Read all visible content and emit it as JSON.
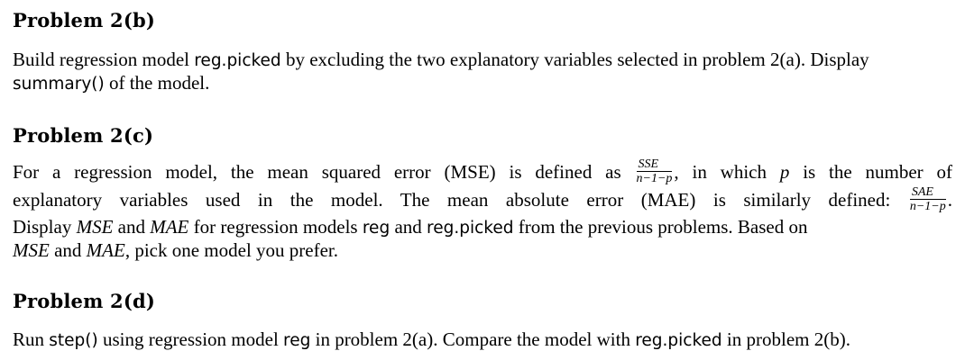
{
  "p2b": {
    "title": "Problem 2(b)",
    "t1": "Build regression model ",
    "c1": "reg.picked",
    "t2": " by excluding the two explanatory variables selected in problem 2(a). Display",
    "c2": "summary()",
    "t3": " of the model."
  },
  "p2c": {
    "title": "Problem 2(c)",
    "l1_a": "For a regression model, the mean squared error (MSE) is defined as",
    "frac1_num": "SSE",
    "frac1_den": "n−1−p",
    "l1_b": ", in which",
    "l1_p": "p",
    "l1_c": "is the number of",
    "l2_a": "explanatory variables used in the model.  The mean absolute error (MAE) is similarly defined:",
    "frac2_num": "SAE",
    "frac2_den": "n−1−p",
    "l2_b": ".",
    "l3_m1": "MSE",
    "l3_a": " and ",
    "l3_m2": "MAE",
    "l3_b": " for regression models ",
    "l3_c1": "reg",
    "l3_c": " and ",
    "l3_c2": "reg.picked",
    "l3_d": " from the previous problems.  Based on",
    "l3_pre": "Display ",
    "l4_m1": "MSE",
    "l4_a": " and ",
    "l4_m2": "MAE",
    "l4_b": ", pick one model you prefer."
  },
  "p2d": {
    "title": "Problem 2(d)",
    "t1": "Run ",
    "c1": "step()",
    "t2": " using regression model ",
    "c2": "reg",
    "t3": " in problem 2(a).  Compare the model with ",
    "c3": "reg.picked",
    "t4": " in problem 2(b)."
  }
}
